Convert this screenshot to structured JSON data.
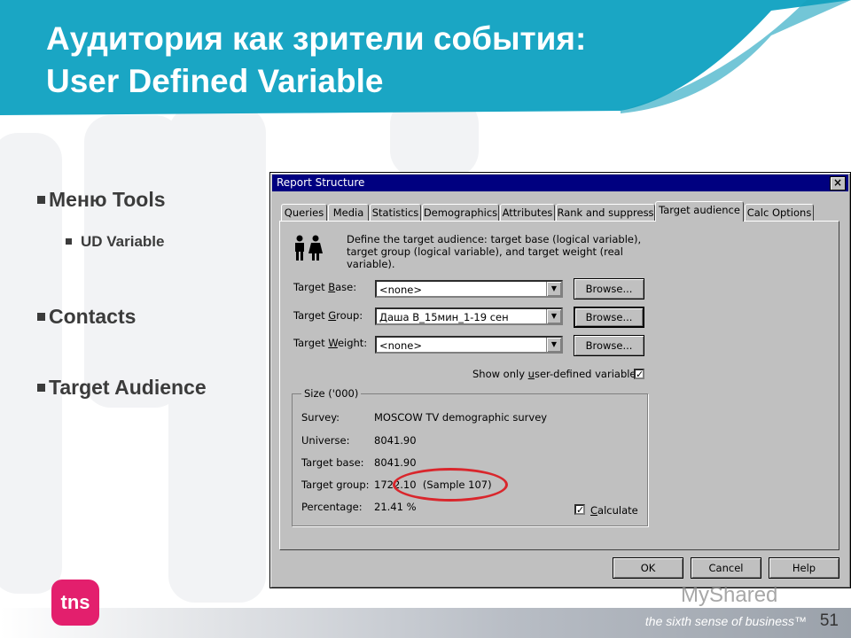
{
  "slide": {
    "title_line1": "Аудитория как зрители события:",
    "title_line2": "User Defined Variable",
    "colors": {
      "header": "#1aa6c4",
      "accent": "#e31f6d",
      "highlight": "#d9262c"
    },
    "bullets": [
      {
        "text": "Меню Tools",
        "level": 1
      },
      {
        "text": "UD Variable",
        "level": 2
      },
      {
        "text": "Contacts",
        "level": 1
      },
      {
        "text": "Target Audience",
        "level": 1
      }
    ],
    "logo": "tns",
    "tagline": "the sixth sense of business™",
    "page_number": "51",
    "watermark": "MyShared"
  },
  "dialog": {
    "title": "Report Structure",
    "close_label": "×",
    "tabs": [
      "Queries",
      "Media",
      "Statistics",
      "Demographics",
      "Attributes",
      "Rank and suppress",
      "Target audience",
      "Calc Options"
    ],
    "active_tab": "Target audience",
    "description": "Define the target audience: target base (logical variable), target group (logical variable), and target weight (real variable).",
    "fields": {
      "target_base": {
        "label_pre": "Target ",
        "label_key": "B",
        "label_post": "ase:",
        "value": "<none>"
      },
      "target_group": {
        "label_pre": "Target ",
        "label_key": "G",
        "label_post": "roup:",
        "value": "Даша В_15мин_1-19 сен"
      },
      "target_weight": {
        "label_pre": "Target ",
        "label_key": "W",
        "label_post": "eight:",
        "value": "<none>"
      }
    },
    "browse_label": "Browse...",
    "show_only_pre": "Show only ",
    "show_only_key": "u",
    "show_only_post": "ser-defined variables",
    "show_only_checked": true,
    "size_group_title": "Size ('000)",
    "size": {
      "survey_label": "Survey:",
      "survey_value": "MOSCOW TV demographic survey",
      "universe_label": "Universe:",
      "universe_value": "8041.90",
      "base_label": "Target base:",
      "base_value": "8041.90",
      "group_label": "Target group:",
      "group_value": "1722.10  (Sample 107)",
      "percentage_label": "Percentage:",
      "percentage_value": "21.41 %"
    },
    "calculate_key": "C",
    "calculate_post": "alculate",
    "calculate_checked": true,
    "ok_label": "OK",
    "cancel_label": "Cancel",
    "help_label": "Help"
  }
}
